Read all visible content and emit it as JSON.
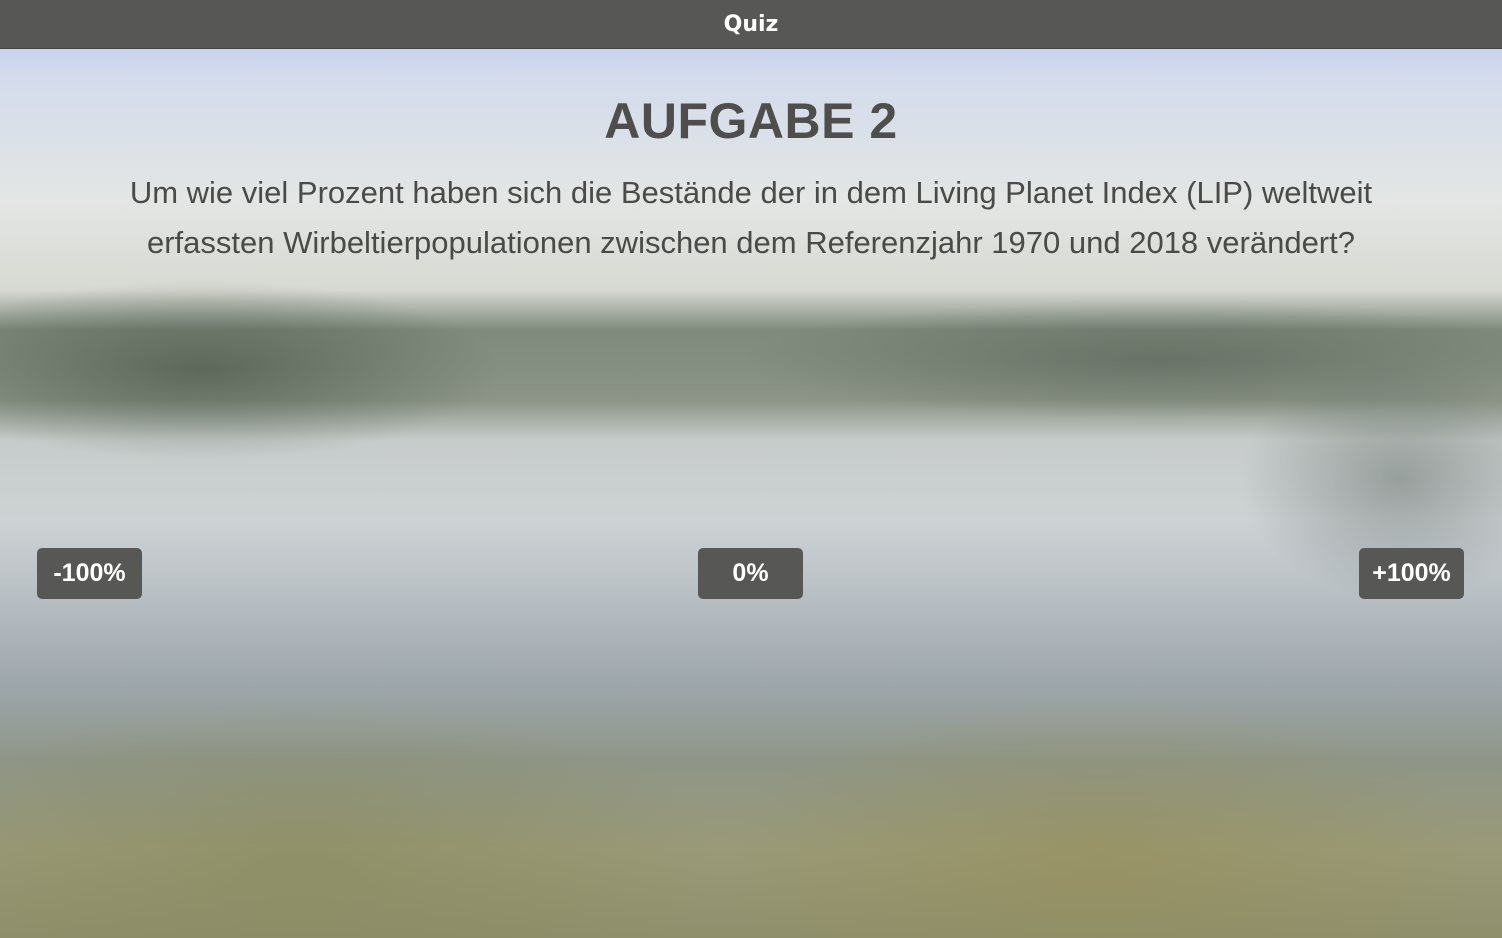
{
  "header": {
    "title": "Quiz"
  },
  "task": {
    "heading": "AUFGABE 2",
    "question": "Um wie viel Prozent haben sich die Bestände der in dem Living Planet Index (LIP) weltweit erfassten Wirbeltierpopulationen zwischen dem Referenzjahr 1970 und 2018 verändert?"
  },
  "scale": {
    "min_label": "-100%",
    "mid_label": "0%",
    "max_label": "+100%"
  },
  "colors": {
    "bar": "#575755",
    "heading_text": "#4e4e4c"
  }
}
